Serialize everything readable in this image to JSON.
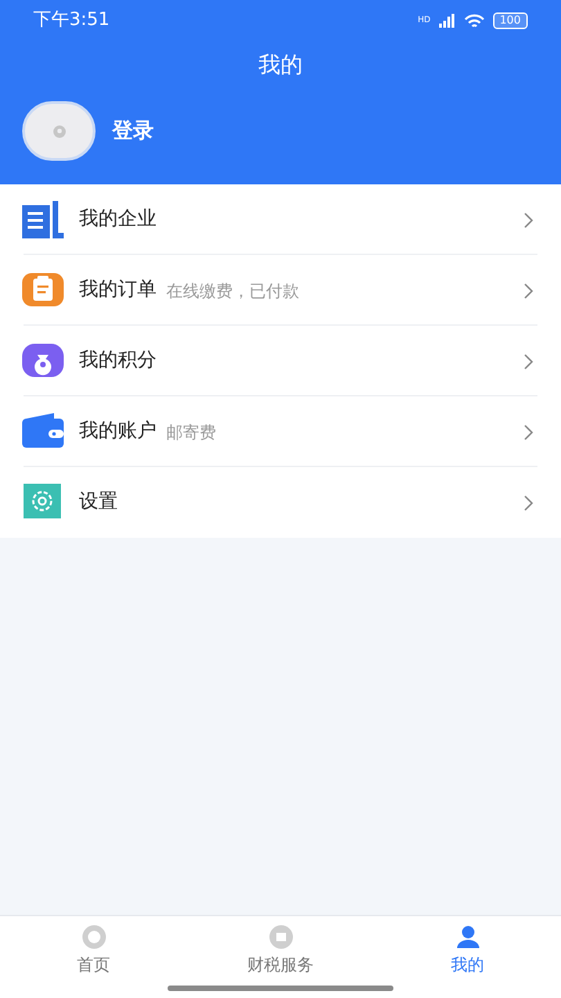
{
  "status_bar": {
    "time": "下午3:51",
    "network": "HD",
    "battery": "100"
  },
  "header": {
    "title": "我的",
    "login": "登录"
  },
  "menu": [
    {
      "kind": "enterprise",
      "label": "我的企业"
    },
    {
      "kind": "orders",
      "label": "我的订单",
      "hint": "在线缴费，已付款"
    },
    {
      "kind": "points",
      "label": "我的积分"
    },
    {
      "kind": "account",
      "label": "我的账户",
      "hint": "邮寄费"
    },
    {
      "kind": "settings",
      "label": "设置"
    }
  ],
  "tabs": [
    {
      "kind": "home",
      "label": "首页",
      "selected": false
    },
    {
      "kind": "service",
      "label": "财税服务",
      "selected": false
    },
    {
      "kind": "me",
      "label": "我的",
      "selected": true
    }
  ]
}
